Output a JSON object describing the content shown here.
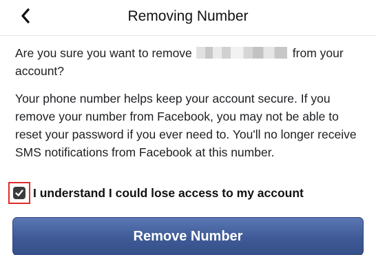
{
  "header": {
    "title": "Removing Number",
    "back_icon": "chevron-left-icon"
  },
  "content": {
    "question_prefix": "Are you sure you want to remove",
    "question_suffix": "from your account?",
    "info_text": "Your phone number helps keep your account secure. If you remove your number from Facebook, you may not be able to reset your password if you ever need to. You'll no longer receive SMS notifications from Facebook at this number."
  },
  "consent": {
    "checked": true,
    "label": "I understand I could lose access to my account",
    "highlight_color": "#e02b2b"
  },
  "actions": {
    "remove_label": "Remove Number",
    "button_color": "#3f5a96"
  }
}
